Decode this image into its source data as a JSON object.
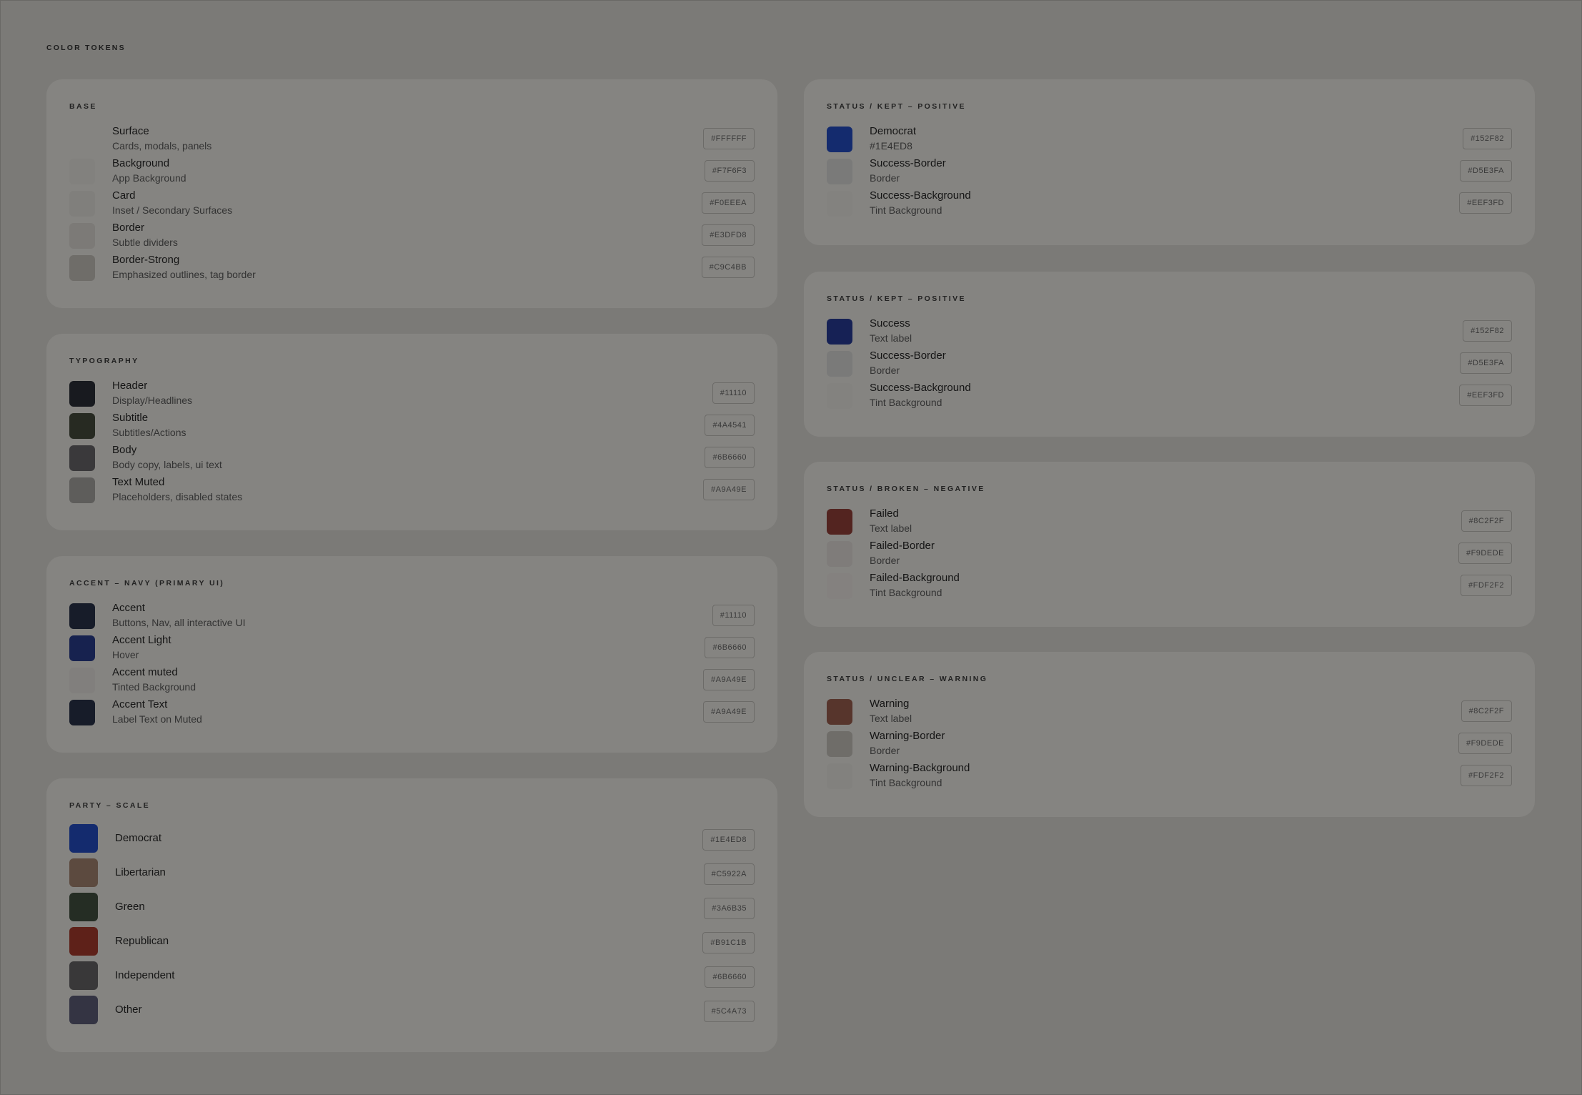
{
  "page_title": "COLOR TOKENS",
  "left_cards": [
    {
      "title": "BASE",
      "rows": [
        {
          "name": "Surface",
          "desc": "Cards, modals, panels",
          "hex": "#FFFFFF",
          "swatch": "#858481"
        },
        {
          "name": "Background",
          "desc": "App Background",
          "hex": "#F7F6F3",
          "swatch": "#82817e"
        },
        {
          "name": "Card",
          "desc": "Inset / Secondary Surfaces",
          "hex": "#F0EEEA",
          "swatch": "#807f7c"
        },
        {
          "name": "Border",
          "desc": "Subtle dividers",
          "hex": "#E3DFD8",
          "swatch": "#7c7a77"
        },
        {
          "name": "Border-Strong",
          "desc": "Emphasized outlines, tag border",
          "hex": "#C9C4BB",
          "swatch": "#6f6d69"
        }
      ]
    },
    {
      "title": "TYPOGRAPHY",
      "rows": [
        {
          "name": "Header",
          "desc": "Display/Headlines",
          "hex": "#11110",
          "swatch": "#181a1f"
        },
        {
          "name": "Subtitle",
          "desc": "Subtitles/Actions",
          "hex": "#4A4541",
          "swatch": "#272a22"
        },
        {
          "name": "Body",
          "desc": "Body copy, labels, ui text",
          "hex": "#6B6660",
          "swatch": "#3a393b"
        },
        {
          "name": "Text Muted",
          "desc": "Placeholders, disabled states",
          "hex": "#A9A49E",
          "swatch": "#5e5d5b"
        }
      ]
    },
    {
      "title": "ACCENT – NAVY (PRIMARY UI)",
      "rows": [
        {
          "name": "Accent",
          "desc": "Buttons, Nav, all interactive UI",
          "hex": "#11110",
          "swatch": "#171c29"
        },
        {
          "name": "Accent Light",
          "desc": "Hover",
          "hex": "#6B6660",
          "swatch": "#17224f"
        },
        {
          "name": "Accent muted",
          "desc": "Tinted Background",
          "hex": "#A9A49E",
          "swatch": "#817f7d"
        },
        {
          "name": "Accent Text",
          "desc": "Label Text on Muted",
          "hex": "#A9A49E",
          "swatch": "#171c29"
        }
      ]
    },
    {
      "title": "PARTY – SCALE",
      "rows": [
        {
          "name": "Democrat",
          "hex": "#1E4ED8",
          "swatch": "#142b6e"
        },
        {
          "name": "Libertarian",
          "hex": "#C5922A",
          "swatch": "#5c4a3f"
        },
        {
          "name": "Green",
          "hex": "#3A6B35",
          "swatch": "#252d24"
        },
        {
          "name": "Republican",
          "hex": "#B91C1B",
          "swatch": "#5e2119"
        },
        {
          "name": "Independent",
          "hex": "#6B6660",
          "swatch": "#393839"
        },
        {
          "name": "Other",
          "hex": "#5C4A73",
          "swatch": "#343443"
        }
      ]
    }
  ],
  "right_cards": [
    {
      "title": "STATUS / KEPT – POSITIVE",
      "rows": [
        {
          "name": "Democrat",
          "desc": "#1E4ED8",
          "hex": "#152F82",
          "swatch": "#142b6e"
        },
        {
          "name": "Success-Border",
          "desc": "Border",
          "hex": "#D5E3FA",
          "swatch": "#7a7a79"
        },
        {
          "name": "Success-Background",
          "desc": "Tint Background",
          "hex": "#EEF3FD",
          "swatch": "#83827f"
        }
      ]
    },
    {
      "title": "STATUS / KEPT – POSITIVE",
      "rows": [
        {
          "name": "Success",
          "desc": "Text label",
          "hex": "#152F82",
          "swatch": "#162155"
        },
        {
          "name": "Success-Border",
          "desc": "Border",
          "hex": "#D5E3FA",
          "swatch": "#7a7a79"
        },
        {
          "name": "Success-Background",
          "desc": "Tint Background",
          "hex": "#EEF3FD",
          "swatch": "#83827f"
        }
      ]
    },
    {
      "title": "STATUS / BROKEN – NEGATIVE",
      "rows": [
        {
          "name": "Failed",
          "desc": "Text label",
          "hex": "#8C2F2F",
          "swatch": "#532420"
        },
        {
          "name": "Failed-Border",
          "desc": "Border",
          "hex": "#F9DEDE",
          "swatch": "#7f7c7a"
        },
        {
          "name": "Failed-Background",
          "desc": "Tint Background",
          "hex": "#FDF2F2",
          "swatch": "#84817f"
        }
      ]
    },
    {
      "title": "STATUS / UNCLEAR – WARNING",
      "rows": [
        {
          "name": "Warning",
          "desc": "Text label",
          "hex": "#8C2F2F",
          "swatch": "#57352c"
        },
        {
          "name": "Warning-Border",
          "desc": "Border",
          "hex": "#F9DEDE",
          "swatch": "#6f6d69"
        },
        {
          "name": "Warning-Background",
          "desc": "Tint Background",
          "hex": "#FDF2F2",
          "swatch": "#82817e"
        }
      ]
    }
  ]
}
